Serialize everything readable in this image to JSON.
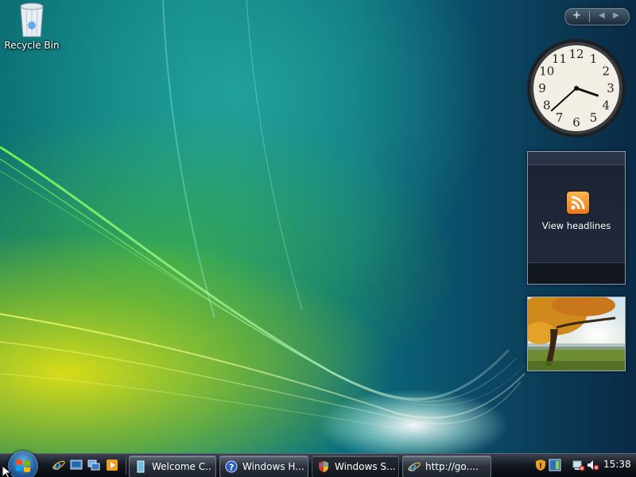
{
  "desktop": {
    "icons": [
      {
        "label": "Recycle Bin",
        "icon": "recycle-bin-icon"
      }
    ]
  },
  "sidebar": {
    "controls": {
      "add_icon": "+",
      "prev_icon": "◀",
      "next_icon": "▶"
    },
    "clock": {
      "hour": 3,
      "minute": 38,
      "numbers": [
        "12",
        "1",
        "2",
        "3",
        "4",
        "5",
        "6",
        "7",
        "8",
        "9",
        "10",
        "11"
      ]
    },
    "feed": {
      "text": "View headlines",
      "icon": "rss-icon"
    },
    "slideshow": {
      "image": "autumn-tree-photo"
    }
  },
  "taskbar": {
    "start_icon": "windows-logo-icon",
    "quick_launch": [
      {
        "icon": "internet-explorer-icon"
      },
      {
        "icon": "show-desktop-icon"
      },
      {
        "icon": "switch-windows-icon"
      },
      {
        "icon": "media-player-icon"
      }
    ],
    "tasks": [
      {
        "label": "Welcome C...",
        "icon": "welcome-center-icon"
      },
      {
        "label": "Windows H...",
        "icon": "help-icon"
      },
      {
        "label": "Windows S...",
        "icon": "security-shield-icon",
        "active": true
      },
      {
        "label": "http://go....",
        "icon": "internet-explorer-icon"
      }
    ],
    "tray": {
      "icons": [
        "security-alert-icon",
        "sidebar-tray-icon",
        "network-disconnected-icon",
        "volume-muted-icon"
      ],
      "time": "15:38"
    }
  }
}
